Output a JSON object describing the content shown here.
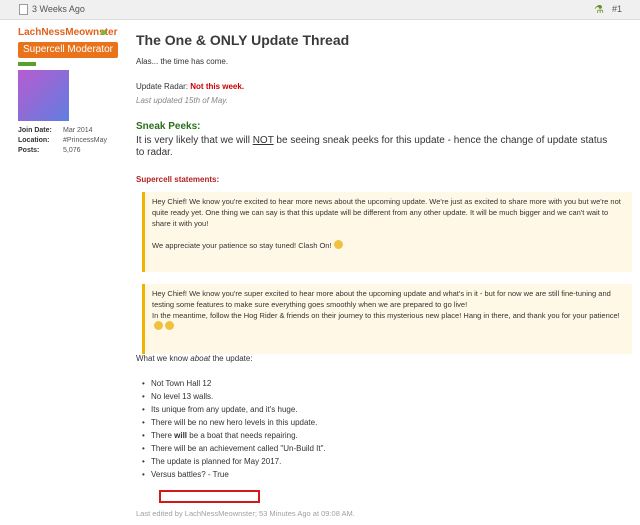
{
  "header": {
    "post_time": "3 Weeks Ago",
    "post_number": "#1"
  },
  "user": {
    "username": "LachNessMeownster",
    "title": "Supercell Moderator",
    "stats": [
      {
        "label": "Join Date:",
        "value": "Mar 2014"
      },
      {
        "label": "Location:",
        "value": "#PrincessMay"
      },
      {
        "label": "Posts:",
        "value": "5,076"
      }
    ]
  },
  "post": {
    "title": "The One & ONLY Update Thread",
    "intro": "Alas... the time has come.",
    "radar_label": "Update Radar:",
    "radar_status": "Not this week.",
    "last_updated": "Last updated 15th of May.",
    "sneak_heading": "Sneak Peeks:",
    "sneak_body_pre": "It is very likely that we will ",
    "sneak_body_not": "NOT",
    "sneak_body_post": " be seeing sneak peeks for this update - hence the change of update status to radar.",
    "statements_heading": "Supercell statements:",
    "quote1_p1": "Hey Chief! We know you're excited to hear more news about the upcoming update. We're just as excited to share more with you but we're not quite ready yet. One thing we can say is that this update will be different from any other update. It will be much bigger and we can't wait to share it with you!",
    "quote1_p2": "We appreciate your patience so stay tuned! Clash On!",
    "quote2_p1": "Hey Chief! We know you're super excited to hear more about the upcoming update and what's in it - but for now we are still fine-tuning and testing some features to make sure everything goes smoothly when we are prepared to go live!",
    "quote2_p2": "In the meantime, follow the Hog Rider & friends on their journey to this mysterious new place! Hang in there, and thank you for your patience!",
    "know_pre": "What we know ",
    "know_em": "aboat",
    "know_post": " the update:",
    "bullets": [
      "Not Town Hall 12",
      "No level 13 walls.",
      "Its unique from any update, and it's huge.",
      "There will be no new hero levels in this update.",
      "There will be a boat that needs repairing.",
      "There will be an achievement called \"Un-Build It\".",
      "The update is planned for May 2017.",
      "Versus battles? - True"
    ],
    "bullet5_pre": "There ",
    "bullet5_bold": "will",
    "bullet5_post": " be a boat that needs repairing.",
    "edited": "Last edited by LachNessMeownster; 53 Minutes Ago at 09:08 AM."
  },
  "colors": {
    "username": "#e0621f",
    "badge": "#e8731b",
    "radar_status": "#cc0000",
    "sneak_heading": "#2c6e1b",
    "statements_heading": "#b22222",
    "highlight_border": "#d01a1a"
  },
  "icons": [
    "document-icon",
    "user-icon",
    "online-status-icon",
    "smiley-icon"
  ]
}
